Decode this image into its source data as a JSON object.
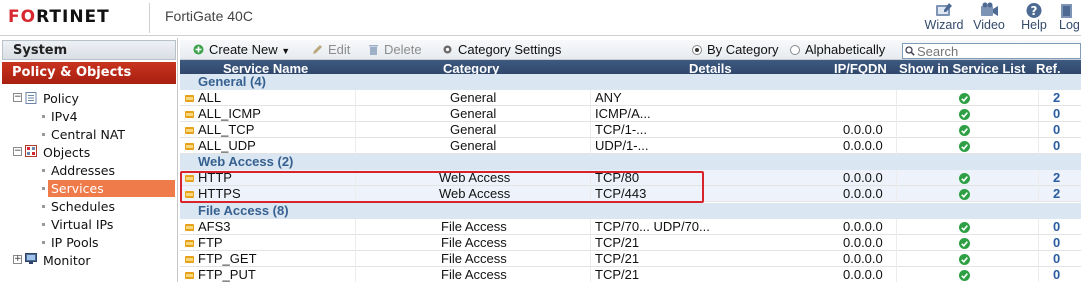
{
  "header": {
    "logo_text": "F",
    "logo_rest": "RTINET",
    "logo_middle": "O",
    "device_name": "FortiGate 40C",
    "buttons": [
      {
        "label": "Wizard",
        "icon": "wizard-icon"
      },
      {
        "label": "Video",
        "icon": "video-icon"
      },
      {
        "label": "Help",
        "icon": "help-icon"
      },
      {
        "label": "Log",
        "icon": "logout-icon"
      }
    ]
  },
  "nav": {
    "system_label": "System",
    "policy_objects_label": "Policy & Objects",
    "tree": {
      "policy": "Policy",
      "ipv4": "IPv4",
      "central_nat": "Central NAT",
      "objects": "Objects",
      "addresses": "Addresses",
      "services": "Services",
      "schedules": "Schedules",
      "virtual_ips": "Virtual IPs",
      "ip_pools": "IP Pools",
      "monitor": "Monitor"
    }
  },
  "toolbar": {
    "create_new": "Create New",
    "edit": "Edit",
    "delete": "Delete",
    "category_settings": "Category Settings",
    "by_category": "By Category",
    "alphabetically": "Alphabetically",
    "search_placeholder": "Search"
  },
  "table": {
    "headers": {
      "service_name": "Service Name",
      "category": "Category",
      "details": "Details",
      "ip_fqdn": "IP/FQDN",
      "show": "Show in Service List",
      "ref": "Ref."
    },
    "groups": [
      {
        "label": "General (4)"
      },
      {
        "label": "Web Access (2)"
      },
      {
        "label": "File Access (8)"
      }
    ],
    "rows": [
      {
        "name": "ALL",
        "category": "General",
        "details": "ANY",
        "ip": "",
        "ref": "2"
      },
      {
        "name": "ALL_ICMP",
        "category": "General",
        "details": "ICMP/A...",
        "ip": "",
        "ref": "0"
      },
      {
        "name": "ALL_TCP",
        "category": "General",
        "details": "TCP/1-...",
        "ip": "0.0.0.0",
        "ref": "0"
      },
      {
        "name": "ALL_UDP",
        "category": "General",
        "details": "UDP/1-...",
        "ip": "0.0.0.0",
        "ref": "0"
      },
      {
        "name": "HTTP",
        "category": "Web Access",
        "details": "TCP/80",
        "ip": "0.0.0.0",
        "ref": "2"
      },
      {
        "name": "HTTPS",
        "category": "Web Access",
        "details": "TCP/443",
        "ip": "0.0.0.0",
        "ref": "2"
      },
      {
        "name": "AFS3",
        "category": "File Access",
        "details": "TCP/70...  UDP/70...",
        "ip": "0.0.0.0",
        "ref": "0"
      },
      {
        "name": "FTP",
        "category": "File Access",
        "details": "TCP/21",
        "ip": "0.0.0.0",
        "ref": "0"
      },
      {
        "name": "FTP_GET",
        "category": "File Access",
        "details": "TCP/21",
        "ip": "0.0.0.0",
        "ref": "0"
      },
      {
        "name": "FTP_PUT",
        "category": "File Access",
        "details": "TCP/21",
        "ip": "0.0.0.0",
        "ref": "0"
      }
    ]
  },
  "colors": {
    "brand_red": "#d7282f",
    "header_blue": "#2d4468",
    "check_green": "#2ea043",
    "ref_blue": "#2a5d9f",
    "highlight_red": "#d8232a"
  }
}
